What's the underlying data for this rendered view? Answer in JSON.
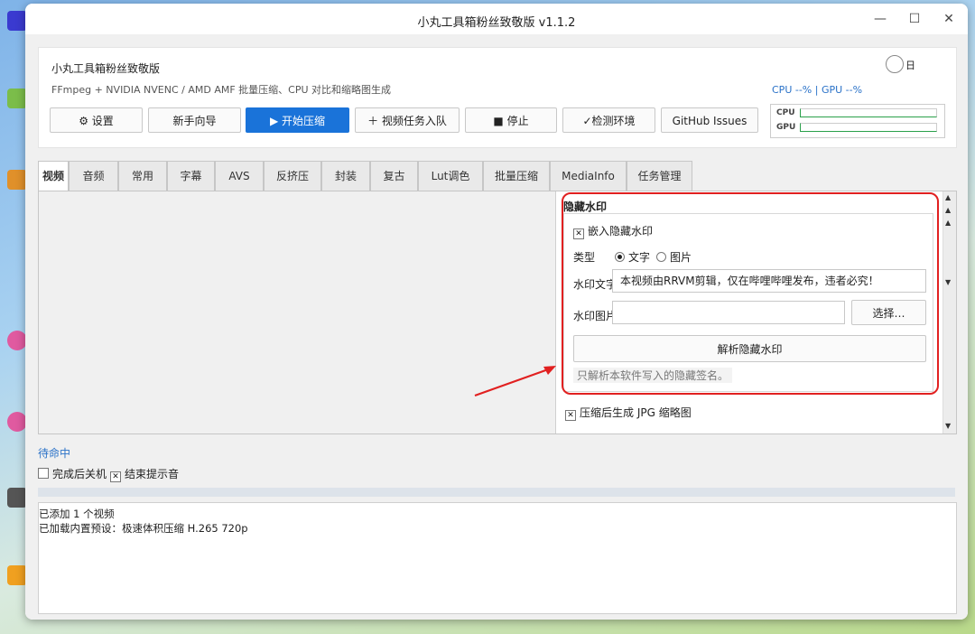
{
  "window": {
    "title": "小丸工具箱粉丝致敬版 v1.1.2",
    "minimize": "—",
    "maximize": "☐",
    "close": "✕"
  },
  "header": {
    "app_name": "小丸工具箱粉丝致敬版",
    "subtitle": "FFmpeg + NVIDIA NVENC / AMD AMF 批量压缩、CPU 对比和缩略图生成",
    "theme_label": "日",
    "cpu_gpu": "CPU --%  |  GPU --%",
    "meter_cpu": "CPU",
    "meter_gpu": "GPU"
  },
  "toolbar": {
    "settings": "⚙ 设置",
    "guide": "新手向导",
    "start": "▶ 开始压缩",
    "enqueue": "＋ 视频任务入队",
    "stop": "■ 停止",
    "check": "✓检测环境",
    "github": "GitHub Issues"
  },
  "tabs": [
    "视频",
    "音频",
    "常用",
    "字幕",
    "AVS",
    "反挤压",
    "封装",
    "复古",
    "Lut调色",
    "批量压缩",
    "MediaInfo",
    "任务管理"
  ],
  "watermark": {
    "group_title": "隐藏水印",
    "embed_label": "嵌入隐藏水印",
    "embed_checked": true,
    "type_label": "类型",
    "type_text": "文字",
    "type_image": "图片",
    "type_selected": "文字",
    "text_label": "水印文字",
    "text_value": "本视频由RRVM剪辑，仅在哔哩哔哩发布，违者必究！",
    "image_label": "水印图片",
    "image_value": "",
    "choose_button": "选择…",
    "parse_button": "解析隐藏水印",
    "hint": "只解析本软件写入的隐藏签名。"
  },
  "thumbnail_option": {
    "label": "压缩后生成 JPG 缩略图",
    "checked": true
  },
  "status": "待命中",
  "options": {
    "shutdown_label": "完成后关机",
    "shutdown_checked": false,
    "sound_label": "结束提示音",
    "sound_checked": true
  },
  "log": [
    "已添加 1 个视频",
    "已加载内置预设：极速体积压缩 H.265 720p"
  ],
  "colors": {
    "accent": "#1a73d9",
    "highlight": "#e12020",
    "meter": "#2aa04a"
  }
}
